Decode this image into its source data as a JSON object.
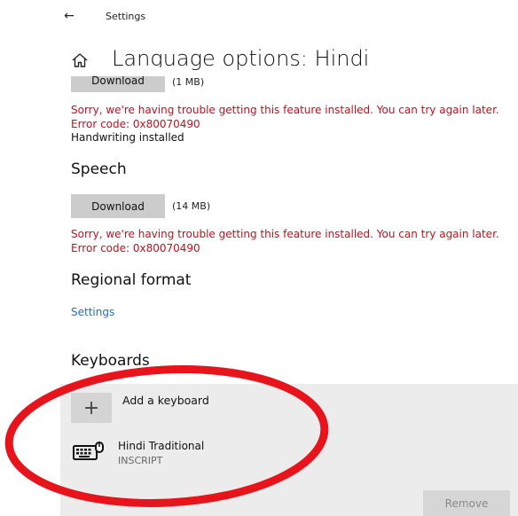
{
  "window": {
    "title": "Settings",
    "back_icon": "arrow-left-icon"
  },
  "header": {
    "home_icon": "home-icon",
    "title": "Language options: Hindi"
  },
  "handwriting": {
    "download_label": "Download",
    "size": "(1 MB)",
    "error": "Sorry, we're having trouble getting this feature installed. You can try again later. Error code: 0x80070490",
    "status": "Handwriting installed"
  },
  "speech": {
    "heading": "Speech",
    "download_label": "Download",
    "size": "(14 MB)",
    "error": "Sorry, we're having trouble getting this feature installed. You can try again later. Error code: 0x80070490"
  },
  "regional": {
    "heading": "Regional format",
    "link": "Settings"
  },
  "keyboards": {
    "heading": "Keyboards",
    "add_label": "Add a keyboard",
    "add_icon": "plus-icon",
    "items": [
      {
        "name": "Hindi Traditional",
        "layout": "INSCRIPT",
        "icon": "keyboard-icon"
      }
    ],
    "remove_label": "Remove"
  },
  "colors": {
    "error": "#c50f1f",
    "link": "#1a73c9",
    "annotation": "#e8141c"
  }
}
